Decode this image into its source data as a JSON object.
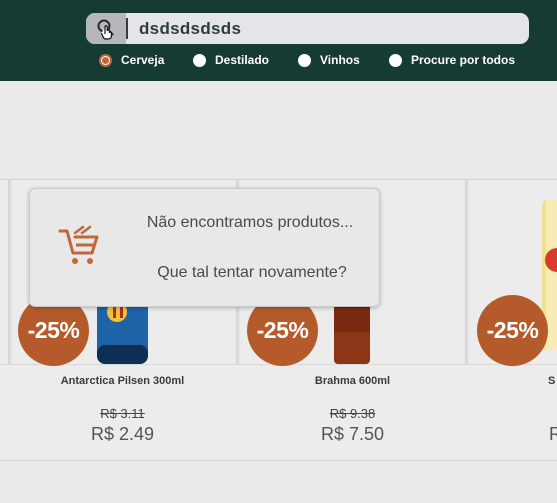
{
  "search": {
    "value": "dsdsdsdsds",
    "icon": "search-icon"
  },
  "filters": [
    {
      "label": "Cerveja",
      "selected": true
    },
    {
      "label": "Destilado",
      "selected": false
    },
    {
      "label": "Vinhos",
      "selected": false
    },
    {
      "label": "Procure por todos",
      "selected": false
    }
  ],
  "colors": {
    "header_bg": "#163a34",
    "accent": "#b55a2a",
    "radio_selected": "#c0683a"
  },
  "empty_state": {
    "message": "Não encontramos produtos...",
    "suggestion": "Que tal tentar novamente?",
    "icon": "cart-icon"
  },
  "products": [
    {
      "name": "Antarctica Pilsen 300ml",
      "old_price": "R$ 3.11",
      "price": "R$ 2.49",
      "discount": "-25%"
    },
    {
      "name": "Brahma 600ml",
      "old_price": "R$ 9.38",
      "price": "R$ 7.50",
      "discount": "-25%"
    },
    {
      "name": "S",
      "old_price": "",
      "price": "R",
      "discount": "-25%"
    }
  ]
}
